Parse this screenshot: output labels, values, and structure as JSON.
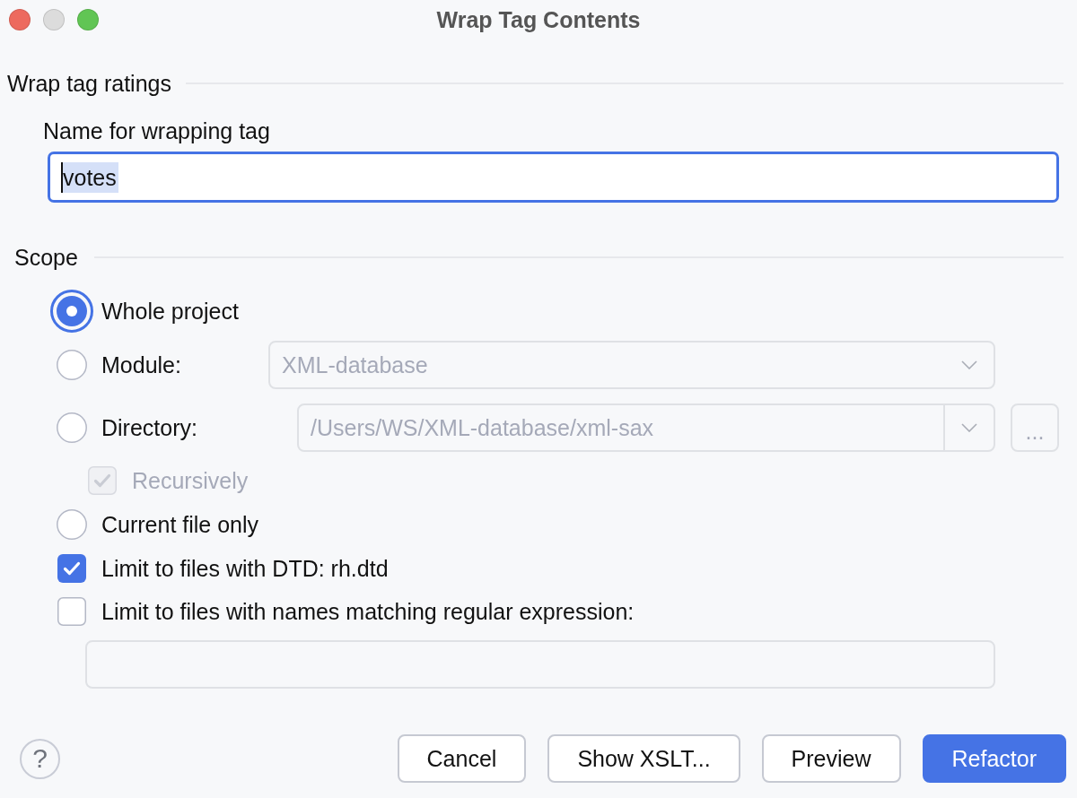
{
  "window": {
    "title": "Wrap Tag Contents",
    "controls": [
      {
        "kind": "close",
        "disabled": false
      },
      {
        "kind": "minimize",
        "disabled": true
      },
      {
        "kind": "zoom",
        "disabled": false
      }
    ]
  },
  "wrap_group": {
    "title": "Wrap tag ratings",
    "name_label": "Name for wrapping tag",
    "name_field": {
      "value": "votes",
      "text_selected": true
    }
  },
  "scope": {
    "title": "Scope",
    "options": [
      {
        "kind": "radio",
        "label": "Whole project",
        "selected": true,
        "disabled": false
      },
      {
        "kind": "radio",
        "label": "Module:",
        "selected": false,
        "disabled": false,
        "combo": {
          "value": "XML-database",
          "disabled": true,
          "editable": false
        }
      },
      {
        "kind": "radio",
        "label": "Directory:",
        "selected": false,
        "disabled": false,
        "combo": {
          "value": "/Users/WS/XML-database/xml-sax",
          "disabled": true,
          "editable": true,
          "browse": {
            "label": "...",
            "disabled": true
          }
        },
        "children": [
          {
            "kind": "checkbox",
            "label": "Recursively",
            "checked": true,
            "disabled": true
          }
        ]
      },
      {
        "kind": "radio",
        "label": "Current file only",
        "selected": false,
        "disabled": false
      },
      {
        "kind": "checkbox",
        "label": "Limit to files with DTD: rh.dtd",
        "checked": true,
        "disabled": false
      },
      {
        "kind": "checkbox",
        "label": "Limit to files with names matching regular expression:",
        "checked": false,
        "disabled": false,
        "pattern_field": {
          "disabled": true
        }
      }
    ]
  },
  "footer": {
    "help": "?",
    "buttons": [
      {
        "label": "Cancel",
        "default": false
      },
      {
        "label": "Show XSLT...",
        "default": false
      },
      {
        "label": "Preview",
        "default": false
      },
      {
        "label": "Refactor",
        "default": true
      }
    ]
  }
}
